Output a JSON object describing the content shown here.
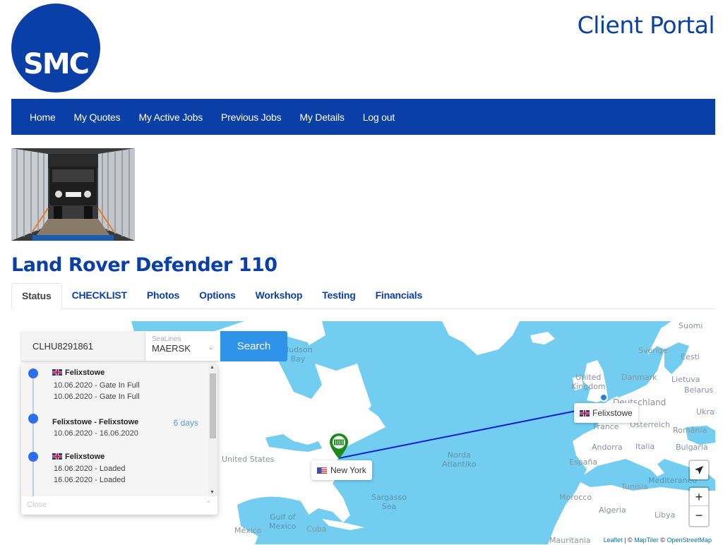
{
  "header": {
    "logo_text": "SMC",
    "portal_title": "Client Portal"
  },
  "nav": {
    "items": [
      {
        "label": "Home"
      },
      {
        "label": "My Quotes"
      },
      {
        "label": "My Active Jobs"
      },
      {
        "label": "Previous Jobs"
      },
      {
        "label": "My Details"
      },
      {
        "label": "Log out"
      }
    ]
  },
  "vehicle": {
    "title": "Land Rover Defender 110",
    "photo_alt": "Land Rover Defender loaded in shipping container"
  },
  "tabs": [
    {
      "label": "Status",
      "active": true
    },
    {
      "label": "CHECKLIST"
    },
    {
      "label": "Photos"
    },
    {
      "label": "Options"
    },
    {
      "label": "Workshop"
    },
    {
      "label": "Testing"
    },
    {
      "label": "Financials"
    }
  ],
  "tracker": {
    "container_number": "CLHU8291861",
    "sealine_label": "SeaLines",
    "sealine_value": "MAERSK",
    "search_label": "Search",
    "close_label": "Close",
    "timeline": [
      {
        "title": "Felixstowe",
        "flag": "gb",
        "lines": [
          "10.06.2020 - Gate In Full",
          "10.06.2020 - Gate In Full"
        ]
      },
      {
        "title": "Felixstowe - Felixstowe",
        "lines": [
          "10.06.2020 - 16.06.2020"
        ],
        "duration": "6 days"
      },
      {
        "title": "Felixstowe",
        "flag": "gb",
        "lines": [
          "16.06.2020 - Loaded",
          "16.06.2020 - Loaded"
        ]
      }
    ]
  },
  "map": {
    "markers": [
      {
        "label": "New York",
        "flag": "us"
      },
      {
        "label": "Felixstowe",
        "flag": "gb"
      }
    ],
    "place_labels": {
      "hudson_bay": "Hudson\nBay",
      "united_states": "United States",
      "norda_atlantiko": "Norda\nAtlantiko",
      "sargasso_sea": "Sargasso\nSea",
      "gulf_of_mexico": "Gulf of\nMexico",
      "mexico": "México",
      "cuba": "Cuba",
      "suomi": "Suomi",
      "sverige": "Sverige",
      "eesti": "Eesti",
      "united_kingdom": "United\nKingdom",
      "danmark": "Danmark",
      "lietuva": "Lietuva",
      "belarus": "Belarus",
      "deutschland": "Deutschland",
      "ukraine": "Ukrai",
      "france": "France",
      "osterreich": "Österreich",
      "romania": "România",
      "andorra": "Andorra",
      "italia": "Italia",
      "bulgaria": "Bulgaria",
      "espana": "España",
      "tunisia": "Tunisia",
      "mediterraneo": "Mediteraneo",
      "morocco": "Morocco",
      "algeria": "Algeria",
      "libya": "Libya",
      "mauritania": "Mauritania"
    },
    "zoom_in": "+",
    "zoom_out": "−",
    "attribution": {
      "leaflet": "Leaflet",
      "sep": " | © ",
      "maptiler": "MapTiler",
      "osm_prefix": " © ",
      "osm": "OpenStreetMap"
    },
    "colors": {
      "water": "#72cdf0",
      "route": "#0a1fd6",
      "origin_pin": "#1b8a1b",
      "destination_pin": "#2b7fd8"
    }
  }
}
